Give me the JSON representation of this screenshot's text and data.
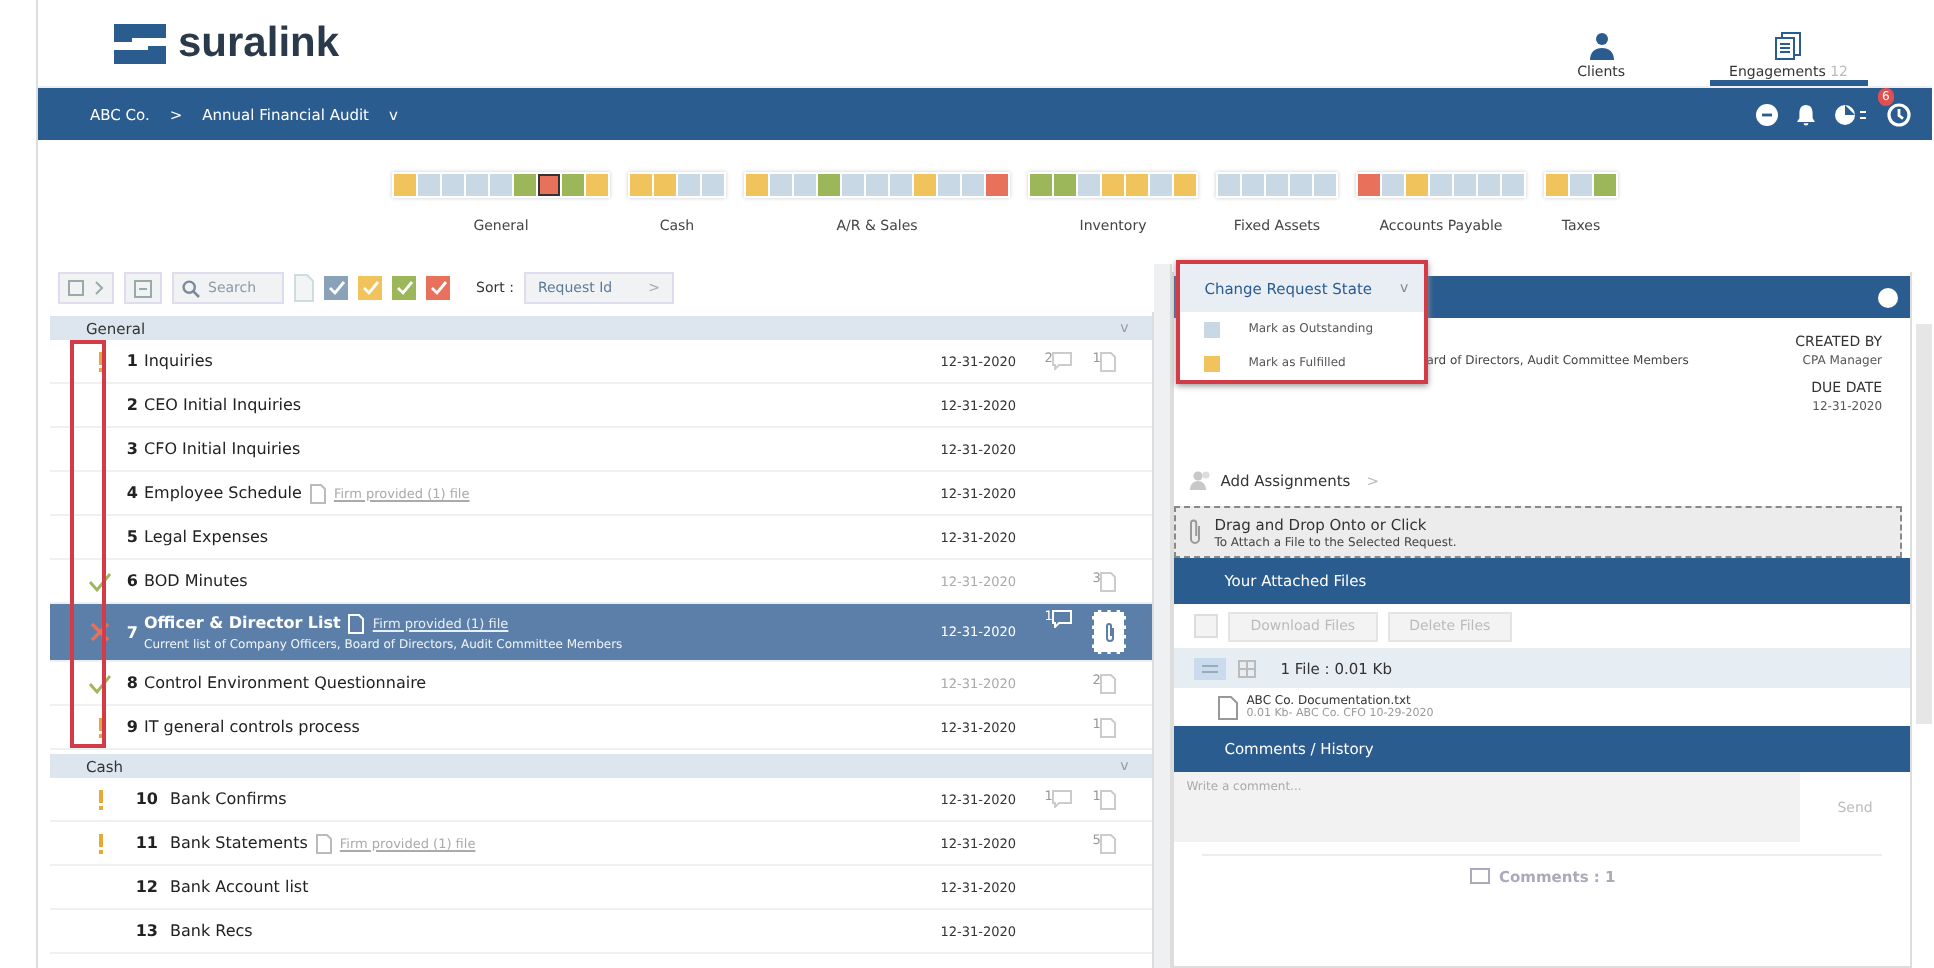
{
  "brand": "suralink",
  "header_tabs": [
    {
      "label": "Clients",
      "selected": false,
      "kind": "clients"
    },
    {
      "label": "Engagements",
      "count": "12",
      "selected": true,
      "kind": "engagements"
    }
  ],
  "breadcrumb": {
    "client": "ABC Co.",
    "separator": ">",
    "engagement": "Annual Financial Audit",
    "caret": "v"
  },
  "notification_badge": "6",
  "progress_groups": [
    {
      "label": "General",
      "cells": [
        {
          "color": "#f0c35c",
          "selected": false
        },
        {
          "color": "#c9d8e5",
          "selected": false
        },
        {
          "color": "#c9d8e5",
          "selected": false
        },
        {
          "color": "#c9d8e5",
          "selected": false
        },
        {
          "color": "#c9d8e5",
          "selected": false
        },
        {
          "color": "#9cb65a",
          "selected": false
        },
        {
          "color": "#e8715b",
          "selected": true
        },
        {
          "color": "#9cb65a",
          "selected": false
        },
        {
          "color": "#f0c35c",
          "selected": false
        }
      ]
    },
    {
      "label": "Cash",
      "cells": [
        {
          "color": "#f0c35c",
          "selected": false
        },
        {
          "color": "#f0c35c",
          "selected": false
        },
        {
          "color": "#c9d8e5",
          "selected": false
        },
        {
          "color": "#c9d8e5",
          "selected": false
        }
      ]
    },
    {
      "label": "A/R & Sales",
      "cells": [
        {
          "color": "#f0c35c",
          "selected": false
        },
        {
          "color": "#c9d8e5",
          "selected": false
        },
        {
          "color": "#c9d8e5",
          "selected": false
        },
        {
          "color": "#9cb65a",
          "selected": false
        },
        {
          "color": "#c9d8e5",
          "selected": false
        },
        {
          "color": "#c9d8e5",
          "selected": false
        },
        {
          "color": "#c9d8e5",
          "selected": false
        },
        {
          "color": "#f0c35c",
          "selected": false
        },
        {
          "color": "#c9d8e5",
          "selected": false
        },
        {
          "color": "#c9d8e5",
          "selected": false
        },
        {
          "color": "#e8715b",
          "selected": false
        }
      ]
    },
    {
      "label": "Inventory",
      "cells": [
        {
          "color": "#9cb65a",
          "selected": false
        },
        {
          "color": "#9cb65a",
          "selected": false
        },
        {
          "color": "#c9d8e5",
          "selected": false
        },
        {
          "color": "#f0c35c",
          "selected": false
        },
        {
          "color": "#f0c35c",
          "selected": false
        },
        {
          "color": "#c9d8e5",
          "selected": false
        },
        {
          "color": "#f0c35c",
          "selected": false
        }
      ]
    },
    {
      "label": "Fixed Assets",
      "cells": [
        {
          "color": "#c9d8e5",
          "selected": false
        },
        {
          "color": "#c9d8e5",
          "selected": false
        },
        {
          "color": "#c9d8e5",
          "selected": false
        },
        {
          "color": "#c9d8e5",
          "selected": false
        },
        {
          "color": "#c9d8e5",
          "selected": false
        }
      ]
    },
    {
      "label": "Accounts Payable",
      "cells": [
        {
          "color": "#e8715b",
          "selected": false
        },
        {
          "color": "#c9d8e5",
          "selected": false
        },
        {
          "color": "#f0c35c",
          "selected": false
        },
        {
          "color": "#c9d8e5",
          "selected": false
        },
        {
          "color": "#c9d8e5",
          "selected": false
        },
        {
          "color": "#c9d8e5",
          "selected": false
        },
        {
          "color": "#c9d8e5",
          "selected": false
        }
      ]
    },
    {
      "label": "Taxes",
      "cells": [
        {
          "color": "#f0c35c",
          "selected": false
        },
        {
          "color": "#c9d8e5",
          "selected": false
        },
        {
          "color": "#9cb65a",
          "selected": false
        }
      ]
    }
  ],
  "toolbar": {
    "search": {
      "placeholder": "Search"
    },
    "filters": [
      {
        "color": "#8aa2b8"
      },
      {
        "color": "#f0c35c"
      },
      {
        "color": "#9cb65a"
      },
      {
        "color": "#e8715b"
      }
    ],
    "sort_label": "Sort :",
    "sort_value": "Request Id",
    "sort_caret": ">"
  },
  "sections": [
    {
      "name": "General",
      "caret": "v",
      "rows": [
        {
          "kind": "alert",
          "number": "1",
          "title": "Inquiries",
          "note": "",
          "subtitle": "",
          "date": "12-31-2020",
          "date_dim": false,
          "comments": "2",
          "files": "1",
          "selected": false
        },
        {
          "kind": "plain",
          "number": "2",
          "title": "CEO Initial Inquiries",
          "note": "",
          "subtitle": "",
          "date": "12-31-2020",
          "date_dim": false,
          "comments": "",
          "files": "",
          "selected": false
        },
        {
          "kind": "plain",
          "number": "3",
          "title": "CFO Initial Inquiries",
          "note": "",
          "subtitle": "",
          "date": "12-31-2020",
          "date_dim": false,
          "comments": "",
          "files": "",
          "selected": false
        },
        {
          "kind": "plain",
          "number": "4",
          "title": "Employee Schedule",
          "note": "Firm provided (1) file",
          "subtitle": "",
          "date": "12-31-2020",
          "date_dim": false,
          "comments": "",
          "files": "",
          "selected": false
        },
        {
          "kind": "plain",
          "number": "5",
          "title": "Legal Expenses",
          "note": "",
          "subtitle": "",
          "date": "12-31-2020",
          "date_dim": false,
          "comments": "",
          "files": "",
          "selected": false
        },
        {
          "kind": "done",
          "number": "6",
          "title": "BOD Minutes",
          "note": "",
          "subtitle": "",
          "date": "12-31-2020",
          "date_dim": true,
          "comments": "",
          "files": "3",
          "selected": false
        },
        {
          "kind": "rejected",
          "number": "7",
          "title": "Officer & Director List",
          "note": "Firm provided (1) file",
          "subtitle": "Current list of Company Officers, Board of Directors, Audit Committee Members",
          "date": "12-31-2020",
          "date_dim": false,
          "comments": "1",
          "files": "",
          "selected": true
        },
        {
          "kind": "done",
          "number": "8",
          "title": "Control Environment Questionnaire",
          "note": "",
          "subtitle": "",
          "date": "12-31-2020",
          "date_dim": true,
          "comments": "",
          "files": "2",
          "selected": false
        },
        {
          "kind": "alert",
          "number": "9",
          "title": "IT general controls process",
          "note": "",
          "subtitle": "",
          "date": "12-31-2020",
          "date_dim": false,
          "comments": "",
          "files": "1",
          "selected": false
        }
      ]
    },
    {
      "name": "Cash",
      "caret": "v",
      "rows": [
        {
          "kind": "alert",
          "number": "10",
          "title": "Bank Confirms",
          "note": "",
          "subtitle": "",
          "date": "12-31-2020",
          "date_dim": false,
          "comments": "1",
          "files": "1",
          "selected": false
        },
        {
          "kind": "alert",
          "number": "11",
          "title": "Bank Statements",
          "note": "Firm provided (1) file",
          "subtitle": "",
          "date": "12-31-2020",
          "date_dim": false,
          "comments": "",
          "files": "5",
          "selected": false
        },
        {
          "kind": "plain",
          "number": "12",
          "title": "Bank Account list",
          "note": "",
          "subtitle": "",
          "date": "12-31-2020",
          "date_dim": false,
          "comments": "",
          "files": "",
          "selected": false
        },
        {
          "kind": "plain",
          "number": "13",
          "title": "Bank Recs",
          "note": "",
          "subtitle": "",
          "date": "12-31-2020",
          "date_dim": false,
          "comments": "",
          "files": "",
          "selected": false
        }
      ]
    }
  ],
  "state_menu": {
    "title": "Change Request State",
    "caret": "v",
    "items": [
      {
        "label": "Mark as Outstanding",
        "color": "#c9d8e5"
      },
      {
        "label": "Mark as Fulfilled",
        "color": "#f0c35c"
      }
    ]
  },
  "detail": {
    "description_tail": "ard of Directors, Audit Committee Members",
    "created_by_label": "CREATED BY",
    "created_by": "CPA Manager",
    "due_label": "DUE DATE",
    "due_date": "12-31-2020",
    "add_assignments": "Add Assignments",
    "add_caret": ">",
    "drop_title": "Drag and Drop Onto or Click",
    "drop_hint": "To Attach a File to the Selected Request."
  },
  "attached_files": {
    "title": "Your Attached Files",
    "download": "Download Files",
    "delete": "Delete Files",
    "summary": "1 File : 0.01 Kb",
    "files": [
      {
        "name": "ABC Co. Documentation.txt",
        "meta": "0.01 Kb- ABC Co. CFO 10-29-2020"
      }
    ]
  },
  "comments": {
    "title": "Comments / History",
    "placeholder": "Write a comment...",
    "send": "Send",
    "count": "Comments : 1"
  }
}
